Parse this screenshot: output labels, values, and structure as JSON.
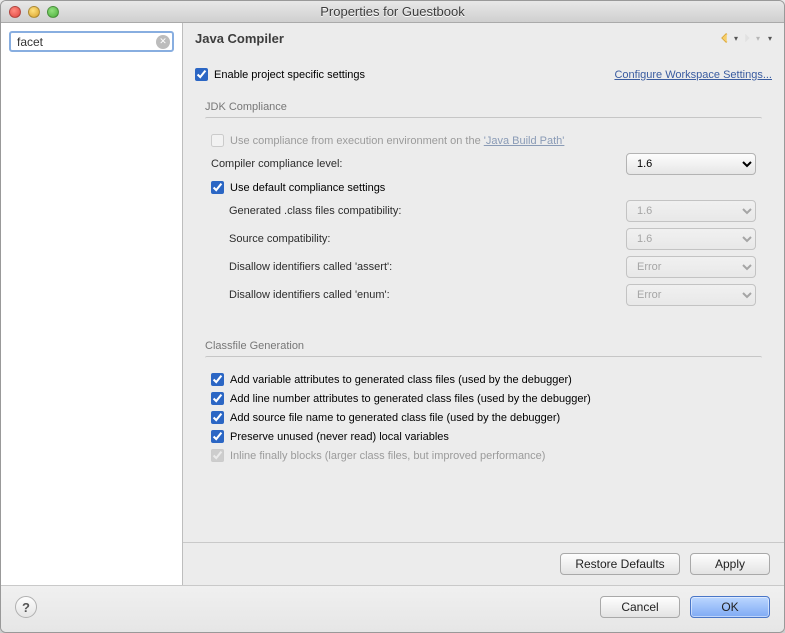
{
  "window": {
    "title": "Properties for Guestbook"
  },
  "search": {
    "value": "facet"
  },
  "page": {
    "title": "Java Compiler",
    "enable_label": "Enable project specific settings",
    "configure_link": "Configure Workspace Settings..."
  },
  "jdk": {
    "section_title": "JDK Compliance",
    "use_exec_env": "Use compliance from execution environment on the ",
    "build_path_link": "'Java Build Path'",
    "compliance_level_label": "Compiler compliance level:",
    "compliance_level_value": "1.6",
    "use_default_label": "Use default compliance settings",
    "generated_compat_label": "Generated .class files compatibility:",
    "generated_compat_value": "1.6",
    "source_compat_label": "Source compatibility:",
    "source_compat_value": "1.6",
    "disallow_assert_label": "Disallow identifiers called 'assert':",
    "disallow_assert_value": "Error",
    "disallow_enum_label": "Disallow identifiers called 'enum':",
    "disallow_enum_value": "Error"
  },
  "classfile": {
    "section_title": "Classfile Generation",
    "add_var": "Add variable attributes to generated class files (used by the debugger)",
    "add_line": "Add line number attributes to generated class files (used by the debugger)",
    "add_src": "Add source file name to generated class file (used by the debugger)",
    "preserve": "Preserve unused (never read) local variables",
    "inline": "Inline finally blocks (larger class files, but improved performance)"
  },
  "buttons": {
    "restore": "Restore Defaults",
    "apply": "Apply",
    "cancel": "Cancel",
    "ok": "OK"
  }
}
